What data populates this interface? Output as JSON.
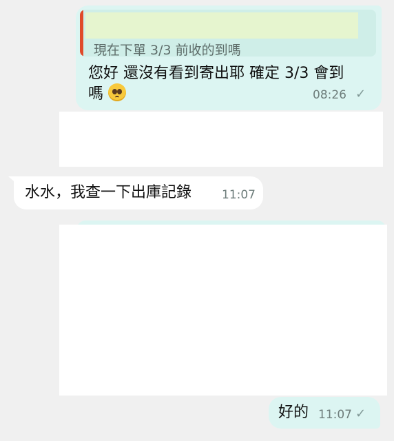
{
  "messages": [
    {
      "reply_quote": "現在下單 3/3 前收的到嗎",
      "line1": "您好 還沒有看到寄出耶 確定 3/3 會到",
      "line2": "嗎",
      "emoji": "pleading-face",
      "time": "08:26",
      "status_icon": "single-check-icon"
    },
    {
      "text": "水水，我查一下出庫記錄",
      "time": "11:07"
    },
    {
      "text": "好的",
      "time": "11:07",
      "status_icon": "single-check-icon"
    }
  ],
  "colors": {
    "outgoing_bubble": "#dcf5f2",
    "incoming_bubble": "#ffffff",
    "background": "#f0f0f0",
    "reply_bar": "#e04a2a"
  }
}
